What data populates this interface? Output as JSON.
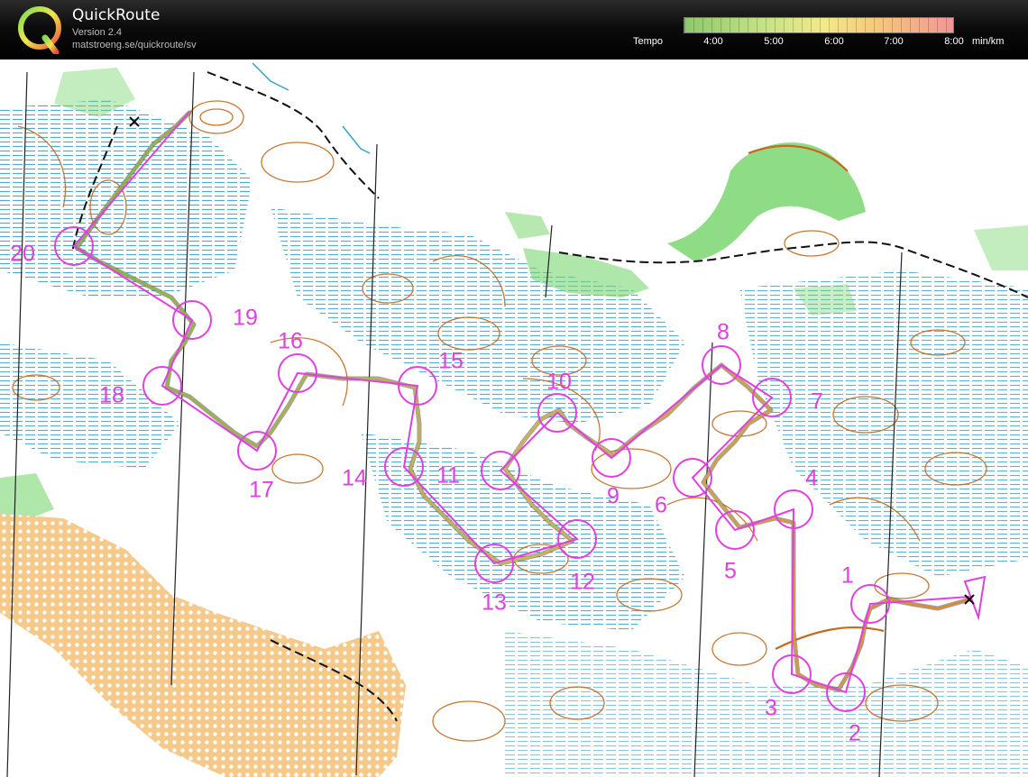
{
  "app": {
    "title": "QuickRoute",
    "version": "Version 2.4",
    "url": "matstroeng.se/quickroute/sv"
  },
  "pace_scale": {
    "label": "Tempo",
    "ticks": [
      "4:00",
      "5:00",
      "6:00",
      "7:00",
      "8:00"
    ],
    "unit": "min/km"
  },
  "course": {
    "controls": [
      {
        "label": "1"
      },
      {
        "label": "2"
      },
      {
        "label": "3"
      },
      {
        "label": "4"
      },
      {
        "label": "5"
      },
      {
        "label": "6"
      },
      {
        "label": "7"
      },
      {
        "label": "8"
      },
      {
        "label": "9"
      },
      {
        "label": "10"
      },
      {
        "label": "11"
      },
      {
        "label": "12"
      },
      {
        "label": "13"
      },
      {
        "label": "14"
      },
      {
        "label": "15"
      },
      {
        "label": "16"
      },
      {
        "label": "17"
      },
      {
        "label": "18"
      },
      {
        "label": "19"
      },
      {
        "label": "20"
      }
    ]
  },
  "colors": {
    "course": "#e040e0",
    "route_slow": "#d58a3c",
    "route_fast": "#8ab04a",
    "contour": "#c46a1e",
    "marsh": "#3aa0c8",
    "vegetation": "#7ad670",
    "open_land": "#f4c98a"
  },
  "icons": {
    "logo": "quickroute-q-logo",
    "start": "start-triangle",
    "finish": "finish-circle"
  }
}
